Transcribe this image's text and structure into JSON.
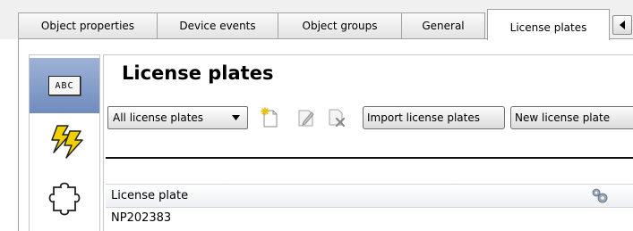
{
  "tabs": [
    {
      "label": "Object properties",
      "active": false
    },
    {
      "label": "Device events",
      "active": false
    },
    {
      "label": "Object groups",
      "active": false
    },
    {
      "label": "General",
      "active": false
    },
    {
      "label": "License plates",
      "active": true
    }
  ],
  "sidebar": {
    "items": [
      {
        "icon": "license-plate-abc-icon",
        "label": "ABC",
        "selected": true
      },
      {
        "icon": "lightning-bolts-icon",
        "selected": false
      },
      {
        "icon": "puzzle-piece-icon",
        "selected": false
      }
    ]
  },
  "panel": {
    "title": "License plates",
    "filter": {
      "selected": "All license plates"
    },
    "toolbar": {
      "add_icon": "new-document-icon",
      "edit_icon": "edit-document-icon",
      "delete_icon": "delete-document-icon",
      "import_label": "Import license plates",
      "new_label": "New license plate"
    },
    "grid": {
      "columns": [
        "License plate"
      ],
      "settings_icon": "grid-settings-icon",
      "rows": [
        [
          "NP202383"
        ]
      ]
    }
  },
  "colors": {
    "selected_sidebar": "#7f98c6",
    "tab_border": "#a0a0a0",
    "lightning": "#f2d000"
  }
}
